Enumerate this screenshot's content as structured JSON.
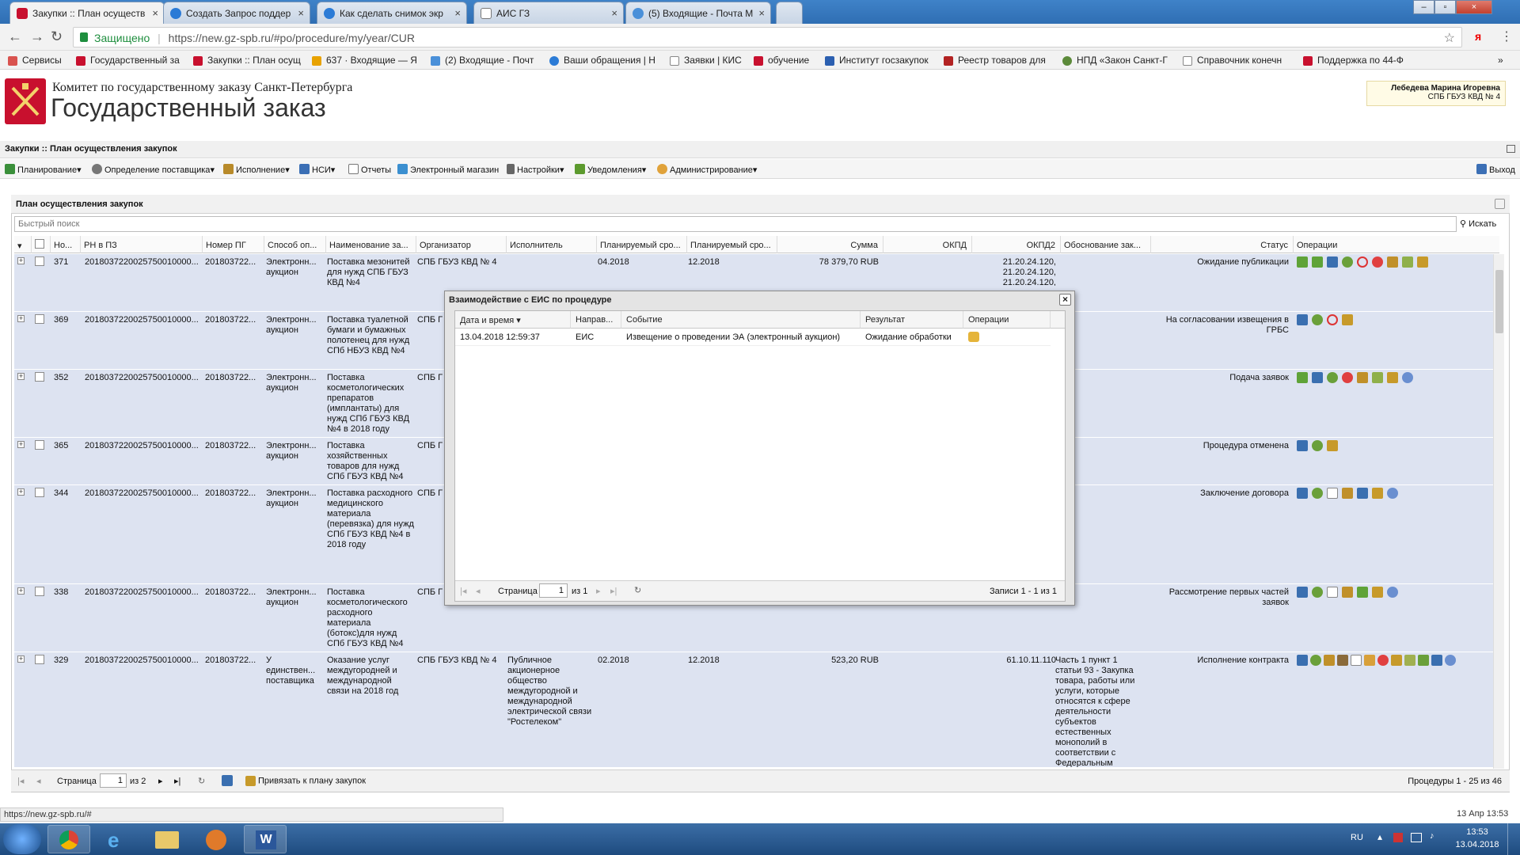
{
  "browser": {
    "tabs": [
      {
        "title": "Закупки :: План осуществ",
        "active": true
      },
      {
        "title": "Создать Запрос поддер",
        "active": false
      },
      {
        "title": "Как сделать снимок экр",
        "active": false
      },
      {
        "title": "АИС ГЗ",
        "active": false
      },
      {
        "title": "(5) Входящие - Почта М",
        "active": false
      }
    ],
    "secure_label": "Защищено",
    "url": "https://new.gz-spb.ru/#po/procedure/my/year/CUR",
    "bookmarks": [
      "Сервисы",
      "Государственный за",
      "Закупки :: План осущ",
      "637 · Входящие — Я",
      "(2) Входящие - Почт",
      "Ваши обращения | Н",
      "Заявки | КИС",
      "обучение",
      "Институт госзакупок",
      "Реестр товаров для",
      "НПД «Закон Санкт-Г",
      "Справочник конечн",
      "Поддержка по 44-Ф"
    ],
    "profile_glyph": "я",
    "status_url": "https://new.gz-spb.ru/#"
  },
  "header": {
    "org_line": "Комитет по государственному заказу Санкт-Петербурга",
    "app_title": "Государственный заказ",
    "user_name": "Лебедева Марина Игоревна",
    "user_org": "СПБ ГБУЗ КВД № 4"
  },
  "breadcrumb": "Закупки :: План осуществления закупок",
  "menu": [
    "Планирование",
    "Определение поставщика",
    "Исполнение",
    "НСИ",
    "Отчеты",
    "Электронный магазин",
    "Настройки",
    "Уведомления",
    "Администрирование"
  ],
  "exit_label": "Выход",
  "panel": {
    "title": "План осуществления закупок",
    "search_placeholder": "Быстрый поиск",
    "search_button": "Искать",
    "columns": [
      "Но...",
      "РН в ПЗ",
      "Номер ПГ",
      "Способ оп...",
      "Наименование за...",
      "Организатор",
      "Исполнитель",
      "Планируемый сро...",
      "Планируемый сро...",
      "Сумма",
      "ОКПД",
      "ОКПД2",
      "Обоснование зак...",
      "Статус",
      "Операции"
    ],
    "rows": [
      {
        "no": "371",
        "rn": "2018037220025750010000...",
        "pg": "201803722...",
        "method": "Электронн... аукцион",
        "name": "Поставка мезонитей для нужд СПБ ГБУЗ КВД №4",
        "org": "СПБ ГБУЗ КВД № 4",
        "exec": "",
        "plan1": "04.2018",
        "plan2": "12.2018",
        "sum": "78 379,70 RUB",
        "okpd": "",
        "okpd2": "21.20.24.120, 21.20.24.120, 21.20.24.120,",
        "basis": "",
        "status": "Ожидание публикации",
        "ops": 9
      },
      {
        "no": "369",
        "rn": "2018037220025750010000...",
        "pg": "201803722...",
        "method": "Электронн... аукцион",
        "name": "Поставка туалетной бумаги и бумажных полотенец для нужд СПб НБУЗ КВД №4",
        "org": "СПБ Г",
        "exec": "",
        "plan1": "",
        "plan2": "",
        "sum": "",
        "okpd": "",
        "okpd2": "",
        "basis": "",
        "status": "На согласовании извещения в ГРБС",
        "ops": 4
      },
      {
        "no": "352",
        "rn": "2018037220025750010000...",
        "pg": "201803722...",
        "method": "Электронн... аукцион",
        "name": "Поставка косметологических препаратов (имплантаты) для нужд СПб ГБУЗ КВД №4 в 2018 году",
        "org": "СПБ Г",
        "exec": "",
        "plan1": "",
        "plan2": "",
        "sum": "",
        "okpd": "",
        "okpd2": "",
        "basis": "",
        "status": "Подача заявок",
        "ops": 8
      },
      {
        "no": "365",
        "rn": "2018037220025750010000...",
        "pg": "201803722...",
        "method": "Электронн... аукцион",
        "name": "Поставка хозяйственных товаров для нужд СПб ГБУЗ КВД №4",
        "org": "СПБ Г",
        "exec": "",
        "plan1": "",
        "plan2": "",
        "sum": "",
        "okpd": "",
        "okpd2": "",
        "basis": "",
        "status": "Процедура отменена",
        "ops": 3
      },
      {
        "no": "344",
        "rn": "2018037220025750010000...",
        "pg": "201803722...",
        "method": "Электронн... аукцион",
        "name": "Поставка расходного медицинского материала (перевязка) для нужд СПб ГБУЗ КВД №4 в 2018 году",
        "org": "СПБ Г",
        "exec": "",
        "plan1": "",
        "plan2": "",
        "sum": "",
        "okpd": "",
        "okpd2": "",
        "basis": "",
        "status": "Заключение договора",
        "ops": 7
      },
      {
        "no": "338",
        "rn": "2018037220025750010000...",
        "pg": "201803722...",
        "method": "Электронн... аукцион",
        "name": "Поставка косметологического расходного материала (ботокс)для нужд СПб ГБУЗ КВД №4",
        "org": "СПБ Г",
        "exec": "",
        "plan1": "",
        "plan2": "",
        "sum": "",
        "okpd": "",
        "okpd2": "",
        "basis": "",
        "status": "Рассмотрение первых частей заявок",
        "ops": 7
      },
      {
        "no": "329",
        "rn": "2018037220025750010000...",
        "pg": "201803722...",
        "method": "У единствен... поставщика",
        "name": "Оказание услуг междугородней и международной связи на 2018 год",
        "org": "СПБ ГБУЗ КВД № 4",
        "exec": "Публичное акционерное общество междугородной и международной электрической связи \"Ростелеком\"",
        "plan1": "02.2018",
        "plan2": "12.2018",
        "sum": "523,20 RUB",
        "okpd": "",
        "okpd2": "61.10.11.110",
        "basis": "Часть 1 пункт 1 статьи 93 - Закупка товара, работы или услуги, которые относятся к сфере деятельности субъектов естественных монополий в соответствии с Федеральным",
        "status": "Исполнение контракта",
        "ops": 13
      }
    ],
    "pager": {
      "page_label": "Страница",
      "page": "1",
      "of": "из 2",
      "bind_label": "Привязать к плану закупок",
      "summary": "Процедуры 1 - 25 из 46"
    }
  },
  "dialog": {
    "title": "Взаимодействие с ЕИС по процедуре",
    "columns": [
      "Дата и время",
      "Направ...",
      "Событие",
      "Результат",
      "Операции"
    ],
    "row": {
      "datetime": "13.04.2018 12:59:37",
      "direction": "ЕИС",
      "event": "Извещение о проведении ЭА (электронный аукцион)",
      "result": "Ожидание обработки"
    },
    "pager": {
      "page_label": "Страница",
      "page": "1",
      "of": "из 1",
      "summary": "Записи 1 - 1 из 1"
    }
  },
  "statusbar": {
    "right": "13 Апр 13:53"
  },
  "taskbar": {
    "lang": "RU",
    "time": "13:53",
    "date": "13.04.2018"
  },
  "colors": {
    "row_bg": "#dde3f1",
    "logo_red": "#c8102e",
    "taskbar": "#2a5a90"
  }
}
